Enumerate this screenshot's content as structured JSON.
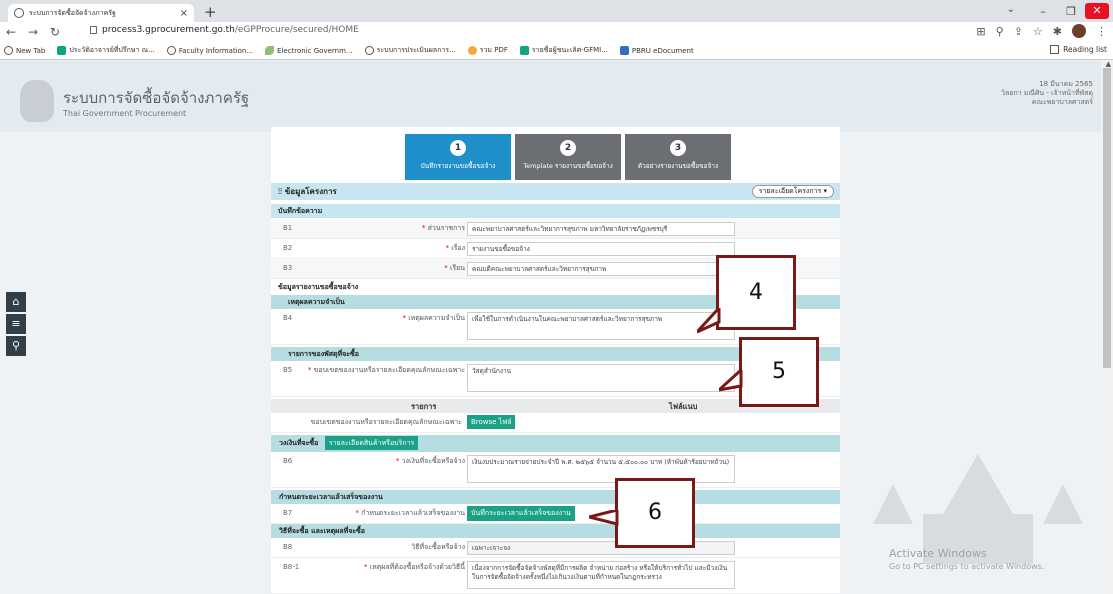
{
  "browser": {
    "tab_title": "ระบบการจัดซื้อจัดจ้างภาครัฐ",
    "url_host": "process3.gprocurement.go.th",
    "url_path": "/eGPProcure/secured/HOME",
    "bookmarks": [
      {
        "label": "New Tab",
        "icon": "globe-icon"
      },
      {
        "label": "ประวัติอาจารย์ที่ปรึกษา ณ...",
        "icon": "sheets-icon"
      },
      {
        "label": "Faculty Information...",
        "icon": "globe-icon"
      },
      {
        "label": "Electronic Governm...",
        "icon": "leaf-icon"
      },
      {
        "label": "ระบบการประเมินผลการ...",
        "icon": "globe-icon"
      },
      {
        "label": "รวม PDF",
        "icon": "drop-icon"
      },
      {
        "label": "รายชื่อผู้ชนะเลิศ-GFMI...",
        "icon": "sheets-icon"
      },
      {
        "label": "PBRU eDocument",
        "icon": "doc-icon"
      }
    ],
    "reading_list": "Reading list"
  },
  "site": {
    "title": "ระบบการจัดซื้อจัดจ้างภาครัฐ",
    "subtitle": "Thai Government Procurement",
    "date": "18 มีนาคม 2565",
    "user": "วิลยกา มณีศิน - เจ้าหน้าที่พัสดุ",
    "dept": "คณะพยาบาลศาสตร์"
  },
  "steps": [
    {
      "num": "1",
      "label": "บันทึกรายงานขอซื้อขอจ้าง"
    },
    {
      "num": "2",
      "label": "Template รายงานขอซื้อขอจ้าง"
    },
    {
      "num": "3",
      "label": "ตัวอย่างรายงานขอซื้อขอจ้าง"
    }
  ],
  "form": {
    "project_info": "ข้อมูลโครงการ",
    "project_details_btn": "รายละเอียดโครงการ ▾",
    "memo_head": "บันทึกข้อความ",
    "b1": {
      "code": "B1",
      "label": "ส่วนราชการ",
      "value": "คณะพยาบาลศาสตร์และวิทยาการสุขภาพ มหาวิทยาลัยราชภัฏเพชรบุรี"
    },
    "b2": {
      "code": "B2",
      "label": "เรื่อง",
      "value": "รายงานขอซื้อขอจ้าง"
    },
    "b3": {
      "code": "B3",
      "label": "เรียน",
      "value": "คณบดีคณะพยาบาลศาสตร์และวิทยาการสุขภาพ"
    },
    "report_head": "ข้อมูลรายงานขอซื้อขอจ้าง",
    "reason_head": "เหตุผลความจำเป็น",
    "b4": {
      "code": "B4",
      "label": "เหตุผลความจำเป็น",
      "value": "เพื่อใช้ในการดำเนินงานในคณะพยาบาลศาสตร์และวิทยาการสุขภาพ"
    },
    "items_head": "รายการของพัสดุที่จะซื้อ",
    "b5": {
      "code": "B5",
      "label": "ขอบเขตของงานหรือรายละเอียดคุณลักษณะเฉพาะ",
      "value": "วัสดุสำนักงาน"
    },
    "tbl_item": "รายการ",
    "tbl_attach": "ไฟล์แนบ",
    "attach_label": "ขอบเขตของงานหรือรายละเอียดคุณลักษณะเฉพาะ",
    "browse_btn": "Browse ไฟล์",
    "budget_head": "วงเงินที่จะซื้อ",
    "budget_btn": "รายละเอียดสินค้าหรือบริการ",
    "b6": {
      "code": "B6",
      "label": "วงเงินที่จะซื้อหรือจ้าง",
      "value": "เงินงบประมาณรายจ่ายประจำปี พ.ศ. ๒๕๖๕ จำนวน ๕,๕๐๐.๐๐ บาท (ห้าพันห้าร้อยบาทถ้วน)"
    },
    "deadline_head": "กำหนดระยะเวลาแล้วเสร็จของงาน",
    "b7": {
      "code": "B7",
      "label": "กำหนดระยะเวลาแล้วเสร็จของงาน",
      "btn": "บันทึกระยะเวลาแล้วเสร็จของงาน"
    },
    "method_head": "วิธีที่จะซื้อ และเหตุผลที่จะซื้อ",
    "b8": {
      "code": "B8",
      "label": "วิธีที่จะซื้อหรือจ้าง",
      "value": "เฉพาะเจาะจง"
    },
    "b81": {
      "code": "B8-1",
      "label": "เหตุผลที่ต้องซื้อหรือจ้างด้วยวิธีนี้",
      "value": "เนื่องจากการจัดซื้อจัดจ้างพัสดุที่มีการผลิต จำหน่าย ก่อสร้าง หรือให้บริการทั่วไป และมีวงเงินในการจัดซื้อจัดจ้างครั้งหนึ่งไม่เกินวงเงินตามที่กำหนดในกฎกระทรวง"
    }
  },
  "callouts": [
    "4",
    "5",
    "6"
  ],
  "activate": {
    "title": "Activate Windows",
    "sub": "Go to PC settings to activate Windows."
  }
}
